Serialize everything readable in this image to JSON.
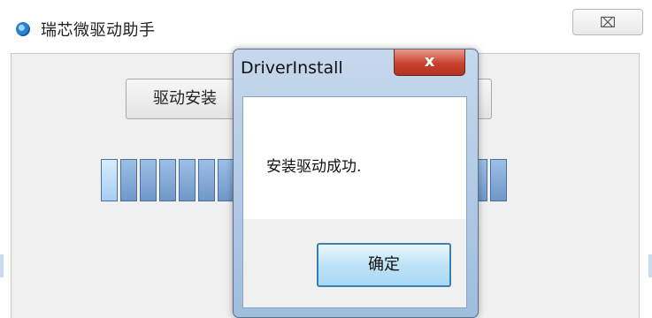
{
  "main_window": {
    "title": "瑞芯微驱动助手",
    "close_label": "⌧",
    "install_button_label": "驱动安装",
    "progress": {
      "total_segments": 21,
      "lit_segments": 1
    }
  },
  "dialog": {
    "title": "DriverInstall",
    "close_label": "x",
    "message": "安装驱动成功.",
    "ok_label": "确定"
  },
  "colors": {
    "dialog_close_red": "#c8422d",
    "progress_blue": "#6f97c9",
    "ok_button_border": "#3c7fb1"
  }
}
